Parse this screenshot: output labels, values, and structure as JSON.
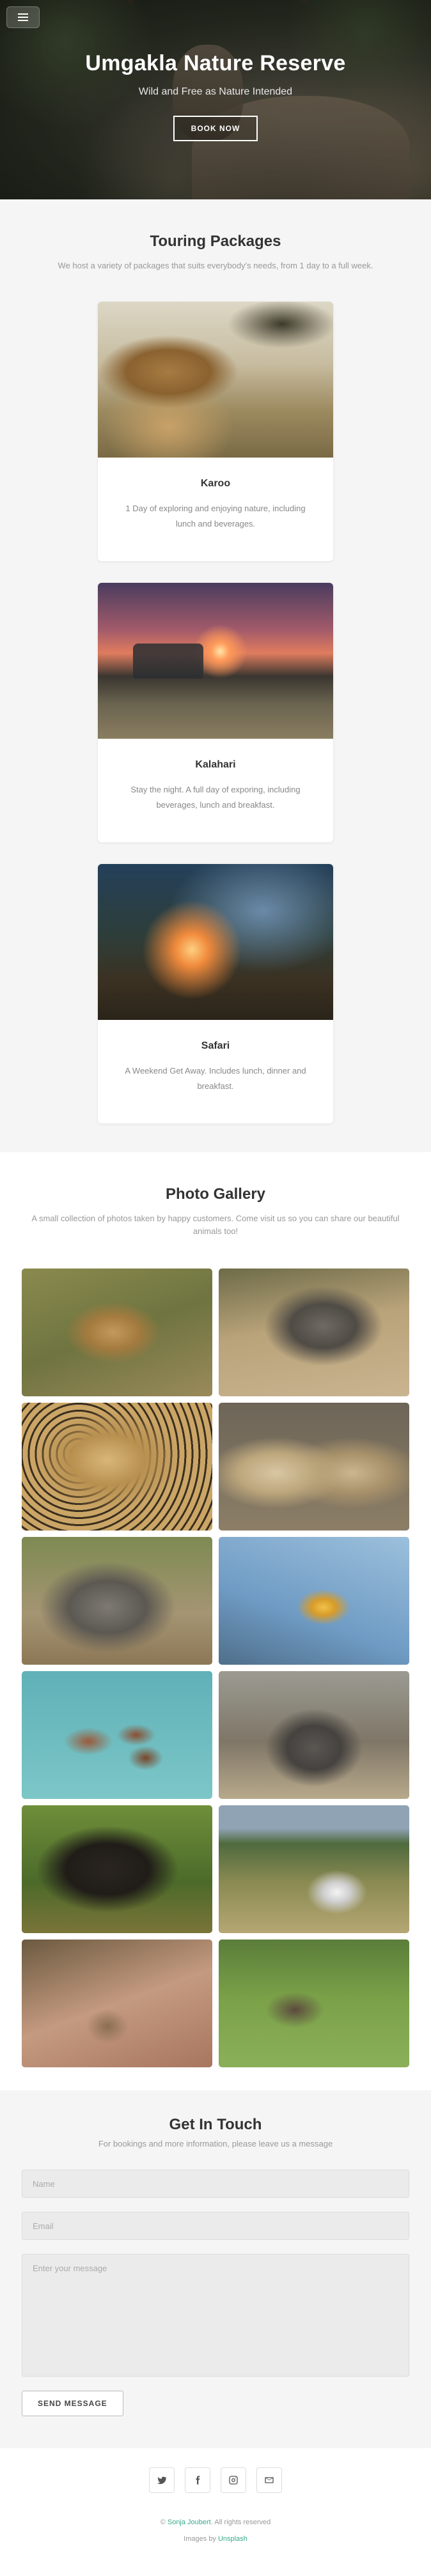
{
  "hero": {
    "title": "Umgakla Nature Reserve",
    "subtitle": "Wild and Free as Nature Intended",
    "book_label": "BOOK NOW"
  },
  "packages": {
    "title": "Touring Packages",
    "subtitle": "We host a variety of packages that suits everybody's needs, from 1 day to a full week.",
    "items": [
      {
        "name": "Karoo",
        "description": "1 Day of exploring and enjoying nature, including lunch and beverages."
      },
      {
        "name": "Kalahari",
        "description": "Stay the night. A full day of exporing, including beverages, lunch and breakfast."
      },
      {
        "name": "Safari",
        "description": "A Weekend Get Away. Includes lunch, dinner and breakfast."
      }
    ]
  },
  "gallery": {
    "title": "Photo Gallery",
    "subtitle": "A small collection of photos taken by happy customers. Come visit us so you can share our beautiful animals too!"
  },
  "contact": {
    "title": "Get In Touch",
    "subtitle": "For bookings and more information, please leave us a message",
    "name_placeholder": "Name",
    "email_placeholder": "Email",
    "message_placeholder": "Enter your message",
    "send_label": "SEND MESSAGE"
  },
  "footer": {
    "social_icons": [
      "twitter-icon",
      "facebook-icon",
      "instagram-icon",
      "email-icon"
    ],
    "copyright_symbol": "©",
    "author": "Sonja Joubert",
    "rights": ". All rights reserved",
    "images_by": "Images by",
    "image_source": "Unsplash"
  },
  "colors": {
    "accent_link": "#3aa98b",
    "section_gray": "#f5f5f5"
  }
}
